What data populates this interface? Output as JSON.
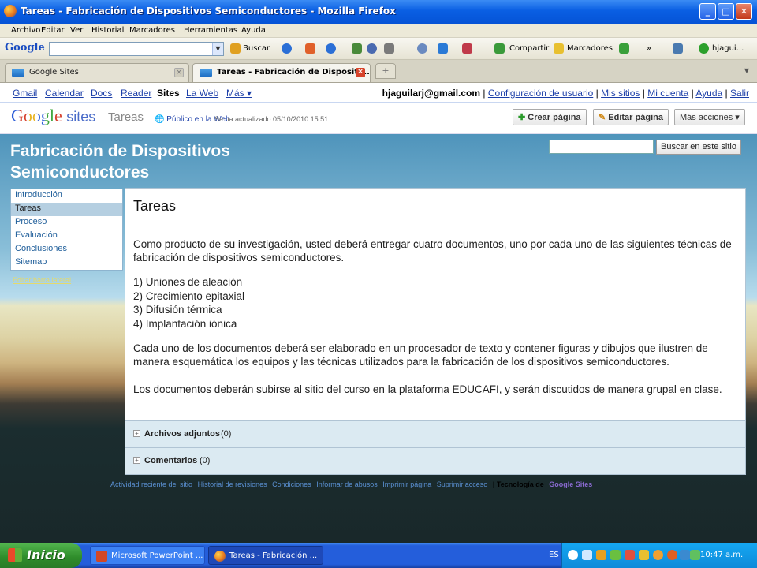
{
  "window": {
    "title": "Tareas - Fabricación de Dispositivos Semiconductores - Mozilla Firefox",
    "controls": {
      "minimize": "_",
      "maximize": "□",
      "close": "✕"
    }
  },
  "menubar": [
    "Archivo",
    "Editar",
    "Ver",
    "Historial",
    "Marcadores",
    "Herramientas",
    "Ayuda"
  ],
  "google_toolbar": {
    "logo": "Google",
    "search_value": "",
    "buscar": "Buscar",
    "compartir": "Compartir",
    "marcadores": "Marcadores",
    "more": "»",
    "user": "hjagui..."
  },
  "tabs": [
    {
      "label": "Google Sites",
      "active": false
    },
    {
      "label": "Tareas - Fabricación de Dispositi...",
      "active": true
    }
  ],
  "newtab": "+",
  "gbar": {
    "links": [
      "Gmail",
      "Calendar",
      "Docs",
      "Reader",
      "Sites",
      "La Web",
      "Más ▾"
    ],
    "current": "Sites",
    "email": "hjaguilarj@gmail.com",
    "right_links": [
      "Configuración de usuario",
      "Mis sitios",
      "Mi cuenta",
      "Ayuda",
      "Salir"
    ]
  },
  "sites_header": {
    "logo_google": "Google",
    "logo_sites": "sites",
    "page_name": "Tareas",
    "visibility": "Público en la Web",
    "updated": "Se ha actualizado 05/10/2010 15:51.",
    "buttons": {
      "create": "Crear página",
      "edit": "Editar página",
      "more": "Más acciones ▾"
    }
  },
  "site": {
    "title_line1": "Fabricación de Dispositivos",
    "title_line2": "Semiconductores",
    "search_placeholder": "",
    "search_button": "Buscar en este sitio"
  },
  "sidebar": {
    "items": [
      "Introducción",
      "Tareas",
      "Proceso",
      "Evaluación",
      "Conclusiones",
      "Sitemap"
    ],
    "active": "Tareas",
    "edit_link": "Editar barra lateral"
  },
  "content": {
    "heading": "Tareas",
    "intro": "Como producto de su investigación, usted deberá entregar cuatro documentos, uno por cada uno de las siguientes técnicas de fabricación de dispositivos semiconductores.",
    "list": [
      "1)  Uniones de aleación",
      "2)  Crecimiento epitaxial",
      "3)  Difusión térmica",
      "4)  Implantación iónica"
    ],
    "para2": "Cada uno de los documentos deberá ser elaborado en un procesador de texto y contener figuras y dibujos que ilustren de manera esquemática los equipos y las técnicas utilizados para la fabricación de los dispositivos semiconductores.",
    "para3": "Los documentos deberán subirse al sitio del curso en la plataforma EDUCAFI, y serán discutidos de manera grupal en clase."
  },
  "attachments": {
    "label": "Archivos adjuntos",
    "count": "(0)"
  },
  "comments": {
    "label": "Comentarios",
    "count": "(0)"
  },
  "footer": {
    "links": [
      "Actividad reciente del sitio",
      "Historial de revisiones",
      "Condiciones",
      "Informar de abusos",
      "Imprimir página",
      "Suprimir acceso"
    ],
    "powered": "Tecnología de",
    "powered_brand": "Google Sites"
  },
  "taskbar": {
    "start": "Inicio",
    "items": [
      "Microsoft PowerPoint ...",
      "Tareas - Fabricación ..."
    ],
    "lang": "ES",
    "clock": "10:47 a.m."
  }
}
